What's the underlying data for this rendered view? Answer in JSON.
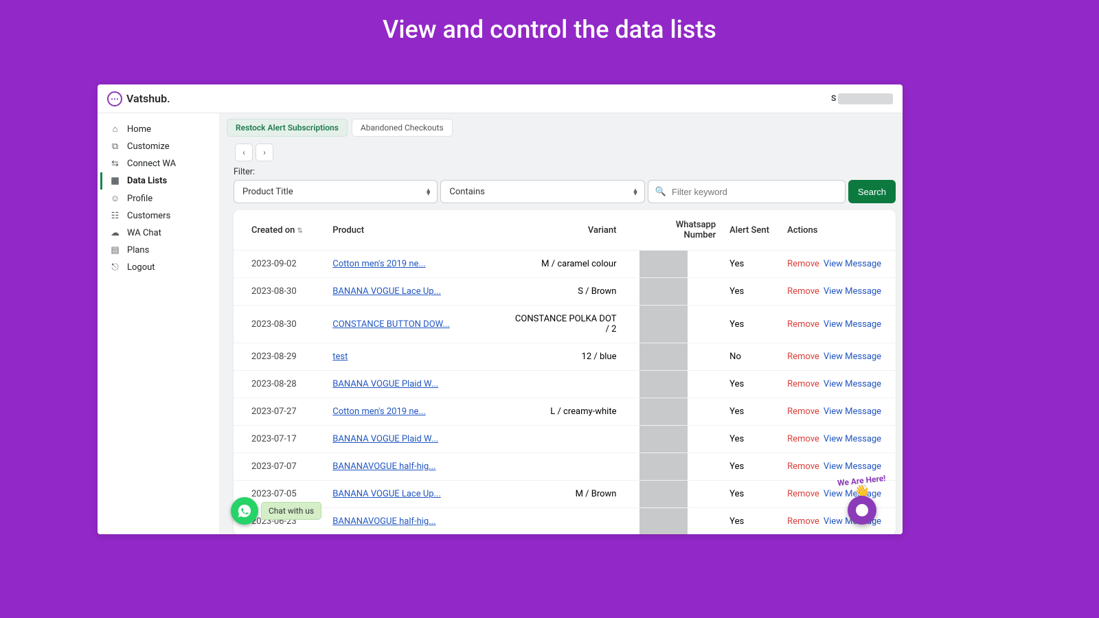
{
  "banner": {
    "title": "View and control the data lists"
  },
  "brand": {
    "name": "Vatshub."
  },
  "sidebar": {
    "items": [
      {
        "label": "Home"
      },
      {
        "label": "Customize"
      },
      {
        "label": "Connect WA"
      },
      {
        "label": "Data Lists"
      },
      {
        "label": "Profile"
      },
      {
        "label": "Customers"
      },
      {
        "label": "WA Chat"
      },
      {
        "label": "Plans"
      },
      {
        "label": "Logout"
      }
    ]
  },
  "tabs": {
    "restock": "Restock Alert Subscriptions",
    "abandoned": "Abandoned Checkouts"
  },
  "pager": {
    "prev": "‹",
    "next": "›"
  },
  "filter": {
    "label": "Filter:",
    "field_select": "Product Title",
    "operator_select": "Contains",
    "search_placeholder": "Filter keyword",
    "search_button": "Search"
  },
  "table": {
    "headers": {
      "created": "Created on",
      "product": "Product",
      "variant": "Variant",
      "wa": "Whatsapp Number",
      "alert": "Alert Sent",
      "actions": "Actions"
    },
    "actions": {
      "remove": "Remove",
      "view": "View Message"
    },
    "rows": [
      {
        "created": "2023-09-02",
        "product": "Cotton men's 2019 ne...",
        "variant": "M / caramel colour",
        "alert": "Yes"
      },
      {
        "created": "2023-08-30",
        "product": "BANANA VOGUE Lace Up...",
        "variant": "S / Brown",
        "alert": "Yes"
      },
      {
        "created": "2023-08-30",
        "product": "CONSTANCE BUTTON DOW...",
        "variant": "CONSTANCE POLKA DOT / 2",
        "alert": "Yes"
      },
      {
        "created": "2023-08-29",
        "product": "test",
        "variant": "12 / blue",
        "alert": "No"
      },
      {
        "created": "2023-08-28",
        "product": "BANANA VOGUE Plaid W...",
        "variant": "",
        "alert": "Yes"
      },
      {
        "created": "2023-07-27",
        "product": "Cotton men's 2019 ne...",
        "variant": "L / creamy-white",
        "alert": "Yes"
      },
      {
        "created": "2023-07-17",
        "product": "BANANA VOGUE Plaid W...",
        "variant": "",
        "alert": "Yes"
      },
      {
        "created": "2023-07-07",
        "product": "BANANAVOGUE half-hig...",
        "variant": "",
        "alert": "Yes"
      },
      {
        "created": "2023-07-05",
        "product": "BANANA VOGUE Lace Up...",
        "variant": "M / Brown",
        "alert": "Yes"
      },
      {
        "created": "2023-06-23",
        "product": "BANANAVOGUE half-hig...",
        "variant": "",
        "alert": "Yes"
      }
    ]
  },
  "chat": {
    "wa_label": "Chat with us",
    "help_text": "We Are Here!"
  }
}
